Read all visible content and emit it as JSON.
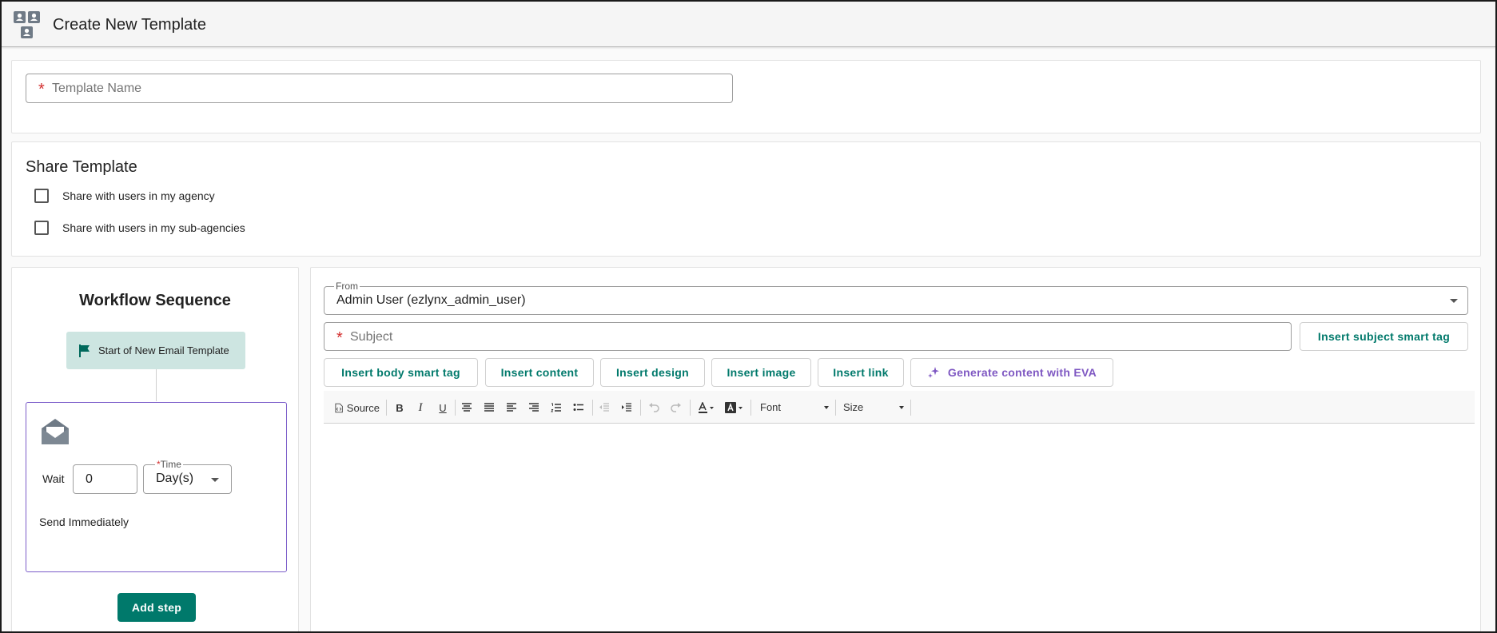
{
  "header": {
    "title": "Create New Template",
    "icon": "template-people-icon"
  },
  "template_name": {
    "placeholder": "Template Name",
    "required_mark": "*"
  },
  "share": {
    "title": "Share Template",
    "options": [
      {
        "label": "Share with users in my agency",
        "checked": false
      },
      {
        "label": "Share with users in my sub-agencies",
        "checked": false
      }
    ]
  },
  "workflow": {
    "title": "Workflow Sequence",
    "start_label": "Start of New Email Template",
    "step": {
      "wait_label": "Wait",
      "wait_value": "0",
      "time_label": "Time",
      "time_required_mark": "*",
      "time_value": "Day(s)",
      "send_label": "Send Immediately"
    },
    "add_step_label": "Add step"
  },
  "editor": {
    "from_label": "From",
    "from_value": "Admin User (ezlynx_admin_user)",
    "subject_placeholder": "Subject",
    "subject_required_mark": "*",
    "insert_subject_smart_tag": "Insert subject smart tag",
    "actions": {
      "body_smart_tag": "Insert body smart tag",
      "content": "Insert content",
      "design": "Insert design",
      "image": "Insert image",
      "link": "Insert link",
      "eva": "Generate content with EVA"
    },
    "toolbar": {
      "source": "Source",
      "bold": "B",
      "italic": "I",
      "underline": "U",
      "font": "Font",
      "size": "Size"
    }
  },
  "colors": {
    "accent": "#00796b",
    "eva": "#7e57c2",
    "required": "#d32f2f",
    "start_bg": "#cde5e1"
  }
}
